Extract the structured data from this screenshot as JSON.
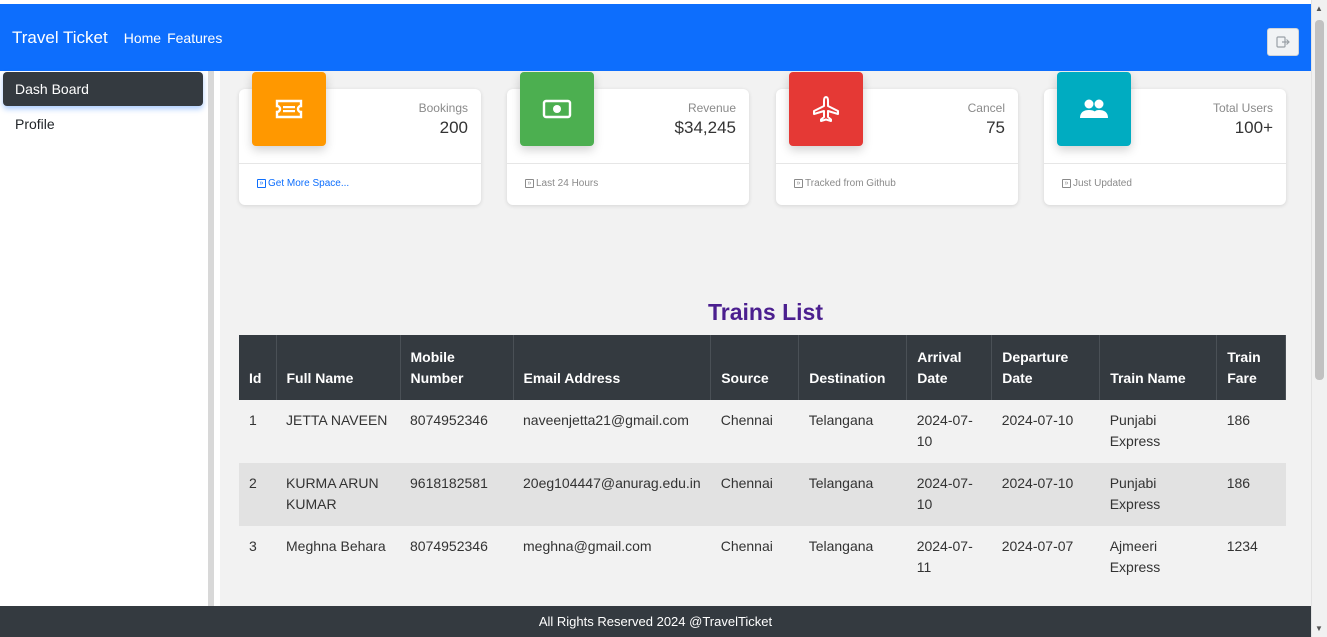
{
  "navbar": {
    "brand": "Travel Ticket",
    "links": [
      "Home",
      "Features"
    ],
    "bg_color": "#0d6efd",
    "logout_icon": "logout-icon"
  },
  "sidebar": {
    "items": [
      {
        "label": "Dash Board",
        "active": true
      },
      {
        "label": "Profile",
        "active": false
      }
    ]
  },
  "stats": [
    {
      "label": "Bookings",
      "value": "200",
      "footer": "Get More Space...",
      "icon": "ticket-icon",
      "color": "#ff9800"
    },
    {
      "label": "Revenue",
      "value": "$34,245",
      "footer": "Last 24 Hours",
      "icon": "money-icon",
      "color": "#4caf50"
    },
    {
      "label": "Cancel",
      "value": "75",
      "footer": "Tracked from Github",
      "icon": "plane-icon",
      "color": "#e53935"
    },
    {
      "label": "Total Users",
      "value": "100+",
      "footer": "Just Updated",
      "icon": "users-icon",
      "color": "#00acc1"
    }
  ],
  "table": {
    "title": "Trains List",
    "headers": [
      "Id",
      "Full Name",
      "Mobile Number",
      "Email Address",
      "Source",
      "Destination",
      "Arrival Date",
      "Departure Date",
      "Train Name",
      "Train Fare"
    ],
    "rows": [
      [
        "1",
        "JETTA NAVEEN",
        "8074952346",
        "naveenjetta21@gmail.com",
        "Chennai",
        "Telangana",
        "2024-07-10",
        "2024-07-10",
        "Punjabi Express",
        "186"
      ],
      [
        "2",
        "KURMA ARUN KUMAR",
        "9618182581",
        "20eg104447@anurag.edu.in",
        "Chennai",
        "Telangana",
        "2024-07-10",
        "2024-07-10",
        "Punjabi Express",
        "186"
      ],
      [
        "3",
        "Meghna Behara",
        "8074952346",
        "meghna@gmail.com",
        "Chennai",
        "Telangana",
        "2024-07-11",
        "2024-07-07",
        "Ajmeeri Express",
        "1234"
      ]
    ]
  },
  "footer": {
    "text": "All Rights Reserved 2024 @TravelTicket"
  }
}
